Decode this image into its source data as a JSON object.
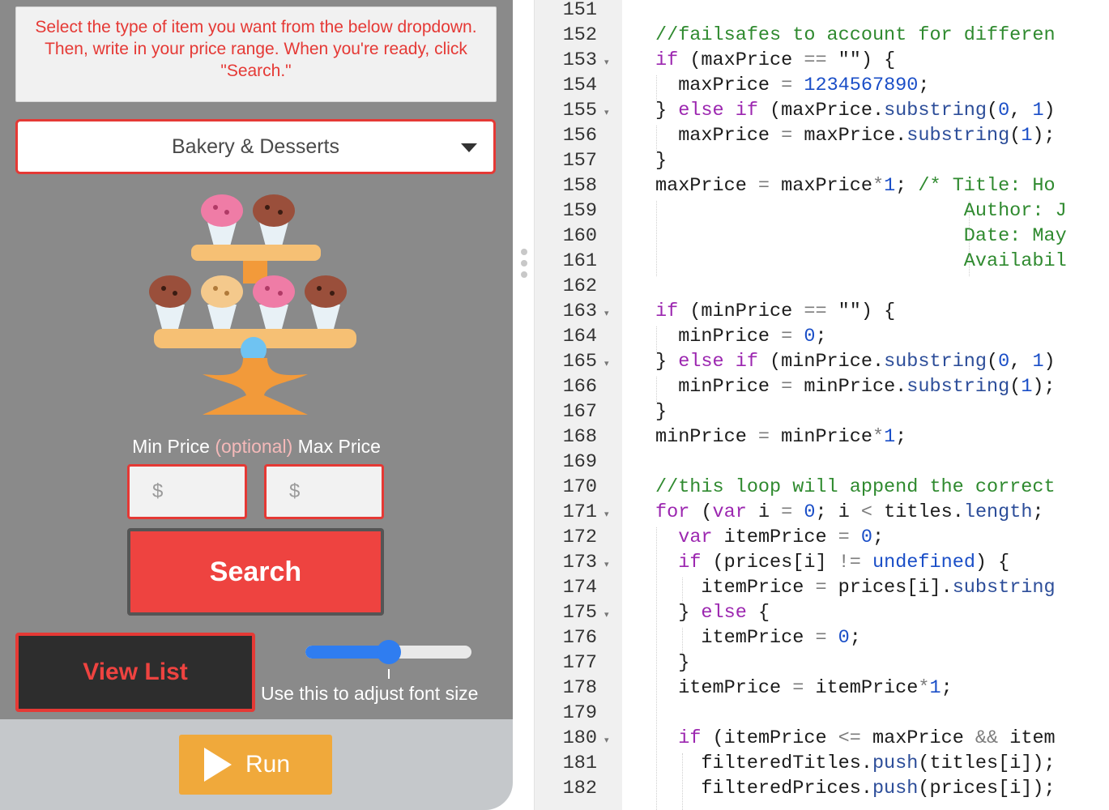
{
  "app": {
    "instructions": "Select the type of item you want from the below dropdown. Then, write in your price range. When you're ready, click \"Search.\"",
    "category_selected": "Bakery & Desserts",
    "image": "cupcake-stand",
    "min_price_label": "Min Price",
    "optional_label": "(optional)",
    "max_price_label": "Max Price",
    "min_price_placeholder": "$",
    "max_price_placeholder": "$",
    "search_label": "Search",
    "view_list_label": "View List",
    "font_slider_value": 0.5,
    "font_slider_caption": "Use this to adjust font size",
    "run_label": "Run"
  },
  "colors": {
    "accent_red": "#e53935",
    "button_red": "#ee4340",
    "run_orange": "#f0a93b",
    "slider_blue": "#2f7df0",
    "screen_gray": "#8a8a8a"
  },
  "editor": {
    "lines": [
      {
        "num": "151",
        "fold": false,
        "code": []
      },
      {
        "num": "152",
        "fold": false,
        "code": [
          [
            "com",
            "//failsafes to account for differen"
          ]
        ]
      },
      {
        "num": "153",
        "fold": true,
        "code": [
          [
            "kw",
            "if"
          ],
          [
            "",
            " (maxPrice "
          ],
          [
            "op",
            "=="
          ],
          [
            "",
            " \"\") {"
          ]
        ]
      },
      {
        "num": "154",
        "fold": false,
        "code": [
          [
            "",
            "  maxPrice "
          ],
          [
            "op",
            "="
          ],
          [
            "",
            " "
          ],
          [
            "num",
            "1234567890"
          ],
          [
            "",
            ";"
          ]
        ]
      },
      {
        "num": "155",
        "fold": true,
        "code": [
          [
            "",
            "} "
          ],
          [
            "kw",
            "else if"
          ],
          [
            "",
            " (maxPrice."
          ],
          [
            "prop",
            "substring"
          ],
          [
            "",
            "("
          ],
          [
            "num",
            "0"
          ],
          [
            "",
            ", "
          ],
          [
            "num",
            "1"
          ],
          [
            "",
            ")"
          ]
        ]
      },
      {
        "num": "156",
        "fold": false,
        "code": [
          [
            "",
            "  maxPrice "
          ],
          [
            "op",
            "="
          ],
          [
            "",
            " maxPrice."
          ],
          [
            "prop",
            "substring"
          ],
          [
            "",
            "("
          ],
          [
            "num",
            "1"
          ],
          [
            "",
            ");"
          ]
        ]
      },
      {
        "num": "157",
        "fold": false,
        "code": [
          [
            "",
            "}"
          ]
        ]
      },
      {
        "num": "158",
        "fold": false,
        "code": [
          [
            "",
            "maxPrice "
          ],
          [
            "op",
            "="
          ],
          [
            "",
            " maxPrice"
          ],
          [
            "op",
            "*"
          ],
          [
            "num",
            "1"
          ],
          [
            "",
            "; "
          ],
          [
            "com",
            "/* Title: Ho"
          ]
        ]
      },
      {
        "num": "159",
        "fold": false,
        "code": [
          [
            "com",
            "                           Author: J"
          ]
        ]
      },
      {
        "num": "160",
        "fold": false,
        "code": [
          [
            "com",
            "                           Date: May"
          ]
        ]
      },
      {
        "num": "161",
        "fold": false,
        "code": [
          [
            "com",
            "                           Availabil"
          ]
        ]
      },
      {
        "num": "162",
        "fold": false,
        "code": []
      },
      {
        "num": "163",
        "fold": true,
        "code": [
          [
            "kw",
            "if"
          ],
          [
            "",
            " (minPrice "
          ],
          [
            "op",
            "=="
          ],
          [
            "",
            " \"\") {"
          ]
        ]
      },
      {
        "num": "164",
        "fold": false,
        "code": [
          [
            "",
            "  minPrice "
          ],
          [
            "op",
            "="
          ],
          [
            "",
            " "
          ],
          [
            "num",
            "0"
          ],
          [
            "",
            ";"
          ]
        ]
      },
      {
        "num": "165",
        "fold": true,
        "code": [
          [
            "",
            "} "
          ],
          [
            "kw",
            "else if"
          ],
          [
            "",
            " (minPrice."
          ],
          [
            "prop",
            "substring"
          ],
          [
            "",
            "("
          ],
          [
            "num",
            "0"
          ],
          [
            "",
            ", "
          ],
          [
            "num",
            "1"
          ],
          [
            "",
            ")"
          ]
        ]
      },
      {
        "num": "166",
        "fold": false,
        "code": [
          [
            "",
            "  minPrice "
          ],
          [
            "op",
            "="
          ],
          [
            "",
            " minPrice."
          ],
          [
            "prop",
            "substring"
          ],
          [
            "",
            "("
          ],
          [
            "num",
            "1"
          ],
          [
            "",
            ");"
          ]
        ]
      },
      {
        "num": "167",
        "fold": false,
        "code": [
          [
            "",
            "}"
          ]
        ]
      },
      {
        "num": "168",
        "fold": false,
        "code": [
          [
            "",
            "minPrice "
          ],
          [
            "op",
            "="
          ],
          [
            "",
            " minPrice"
          ],
          [
            "op",
            "*"
          ],
          [
            "num",
            "1"
          ],
          [
            "",
            ";"
          ]
        ]
      },
      {
        "num": "169",
        "fold": false,
        "code": []
      },
      {
        "num": "170",
        "fold": false,
        "code": [
          [
            "com",
            "//this loop will append the correct"
          ]
        ]
      },
      {
        "num": "171",
        "fold": true,
        "code": [
          [
            "kw",
            "for"
          ],
          [
            "",
            " ("
          ],
          [
            "kw",
            "var"
          ],
          [
            "",
            " i "
          ],
          [
            "op",
            "="
          ],
          [
            "",
            " "
          ],
          [
            "num",
            "0"
          ],
          [
            "",
            "; i "
          ],
          [
            "op",
            "<"
          ],
          [
            "",
            " titles."
          ],
          [
            "prop",
            "length"
          ],
          [
            "",
            ";"
          ]
        ]
      },
      {
        "num": "172",
        "fold": false,
        "code": [
          [
            "",
            "  "
          ],
          [
            "kw",
            "var"
          ],
          [
            "",
            " itemPrice "
          ],
          [
            "op",
            "="
          ],
          [
            "",
            " "
          ],
          [
            "num",
            "0"
          ],
          [
            "",
            ";"
          ]
        ]
      },
      {
        "num": "173",
        "fold": true,
        "code": [
          [
            "",
            "  "
          ],
          [
            "kw",
            "if"
          ],
          [
            "",
            " (prices[i] "
          ],
          [
            "op",
            "!="
          ],
          [
            "",
            " "
          ],
          [
            "num",
            "undefined"
          ],
          [
            "",
            ") {"
          ]
        ]
      },
      {
        "num": "174",
        "fold": false,
        "code": [
          [
            "",
            "    itemPrice "
          ],
          [
            "op",
            "="
          ],
          [
            "",
            " prices[i]."
          ],
          [
            "prop",
            "substring"
          ]
        ]
      },
      {
        "num": "175",
        "fold": true,
        "code": [
          [
            "",
            "  } "
          ],
          [
            "kw",
            "else"
          ],
          [
            "",
            " {"
          ]
        ]
      },
      {
        "num": "176",
        "fold": false,
        "code": [
          [
            "",
            "    itemPrice "
          ],
          [
            "op",
            "="
          ],
          [
            "",
            " "
          ],
          [
            "num",
            "0"
          ],
          [
            "",
            ";"
          ]
        ]
      },
      {
        "num": "177",
        "fold": false,
        "code": [
          [
            "",
            "  }"
          ]
        ]
      },
      {
        "num": "178",
        "fold": false,
        "code": [
          [
            "",
            "  itemPrice "
          ],
          [
            "op",
            "="
          ],
          [
            "",
            " itemPrice"
          ],
          [
            "op",
            "*"
          ],
          [
            "num",
            "1"
          ],
          [
            "",
            ";"
          ]
        ]
      },
      {
        "num": "179",
        "fold": false,
        "code": []
      },
      {
        "num": "180",
        "fold": true,
        "code": [
          [
            "",
            "  "
          ],
          [
            "kw",
            "if"
          ],
          [
            "",
            " (itemPrice "
          ],
          [
            "op",
            "<="
          ],
          [
            "",
            " maxPrice "
          ],
          [
            "op",
            "&&"
          ],
          [
            "",
            " item"
          ]
        ]
      },
      {
        "num": "181",
        "fold": false,
        "code": [
          [
            "",
            "    filteredTitles."
          ],
          [
            "prop",
            "push"
          ],
          [
            "",
            "(titles[i]);"
          ]
        ]
      },
      {
        "num": "182",
        "fold": false,
        "code": [
          [
            "",
            "    filteredPrices."
          ],
          [
            "prop",
            "push"
          ],
          [
            "",
            "(prices[i]);"
          ]
        ]
      }
    ]
  }
}
